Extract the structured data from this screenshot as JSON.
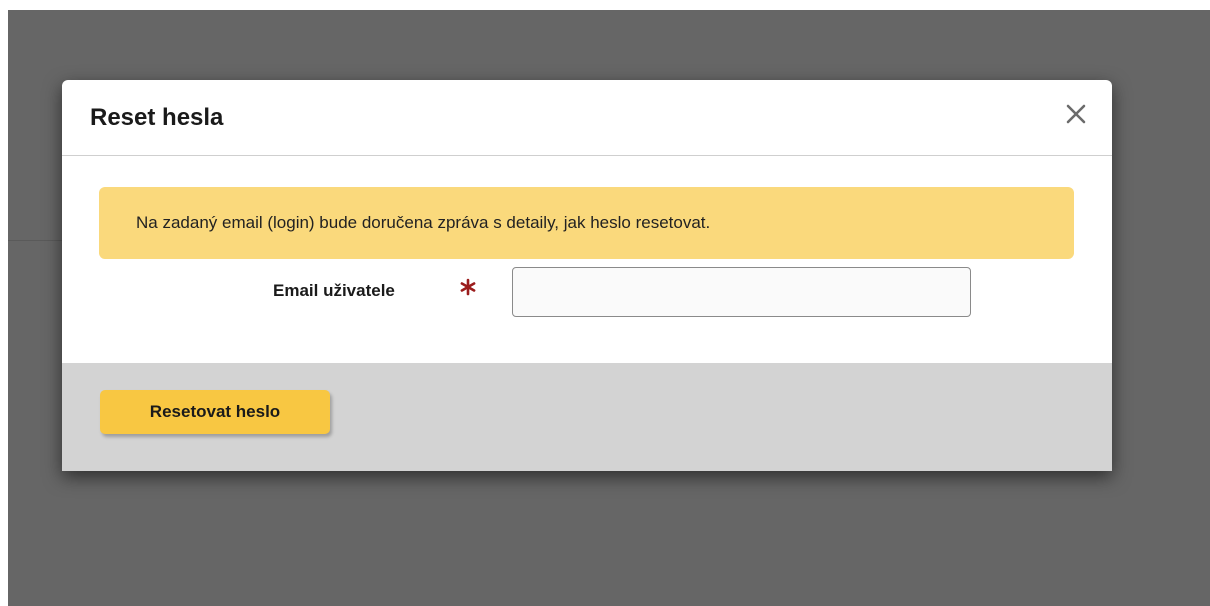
{
  "modal": {
    "title": "Reset hesla",
    "close_icon": "close-icon",
    "alert": {
      "text": "Na zadaný email (login) bude doručena zpráva s detaily, jak heslo resetovat.",
      "color": "#fad97c"
    },
    "form": {
      "email_label": "Email uživatele",
      "required_icon": "asterisk-icon",
      "required_color": "#9b1c1c",
      "email_value": ""
    },
    "footer": {
      "reset_button_label": "Resetovat heslo",
      "button_color": "#f8c742"
    }
  },
  "colors": {
    "backdrop": "#666666",
    "footer_background": "#d3d3d3"
  }
}
